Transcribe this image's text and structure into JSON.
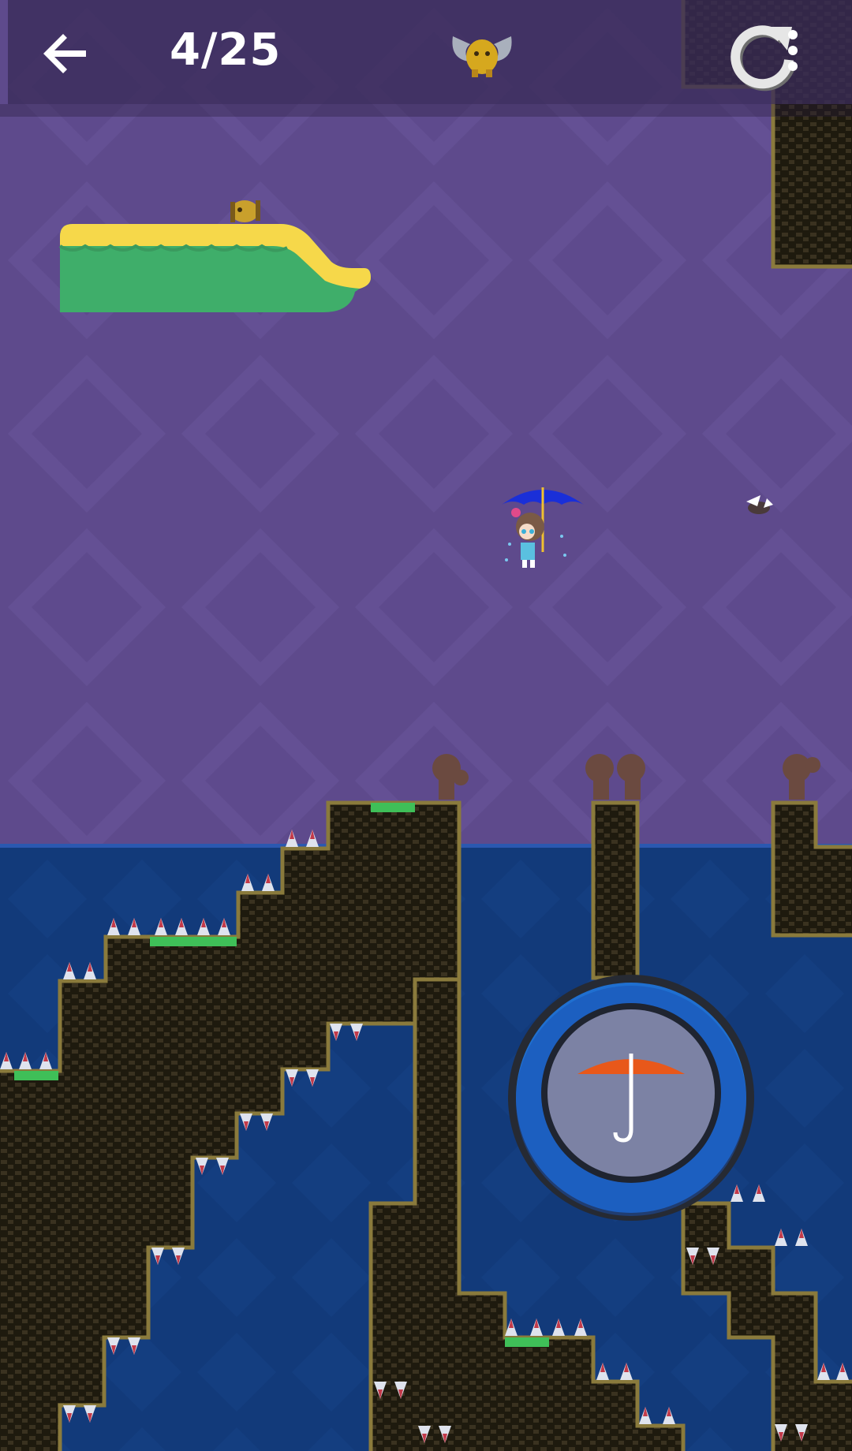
{
  "hud": {
    "level_counter": "4/25",
    "back_icon": "back-arrow-icon",
    "trophy_icon": "winged-bird-trophy-icon",
    "restart_icon": "restart-arrow-icon",
    "menu_icon": "vertical-dots-menu-icon"
  },
  "game": {
    "player": "girl-with-blue-umbrella",
    "action_button_icon": "umbrella-icon",
    "colors": {
      "sky": "#5e4a8c",
      "water": "#123a7a",
      "rock": "#1e1a0e",
      "rock_edge": "#8a7a3c",
      "grass": "#3fbf58",
      "platform_top": "#f6d84a",
      "platform_body": "#3fae6a",
      "umbrella_player": "#1a2fd8",
      "umbrella_icon": "#e8581a",
      "button_ring": "#1f6fd0"
    }
  }
}
